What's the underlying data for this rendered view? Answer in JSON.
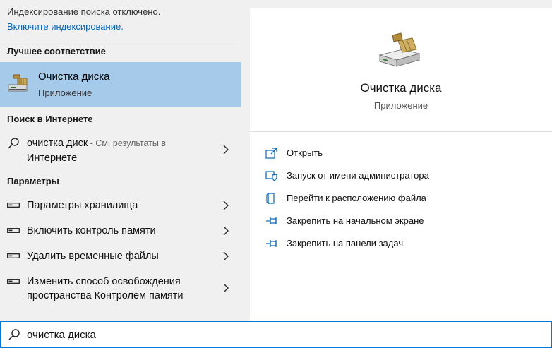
{
  "notice": {
    "text": "Индексирование поиска отключено.",
    "link": "Включите индексирование."
  },
  "best_match": {
    "header": "Лучшее соответствие",
    "title": "Очистка диска",
    "subtitle": "Приложение"
  },
  "web": {
    "header": "Поиск в Интернете",
    "query": "очистка диск",
    "suffix_line1": " - См. результаты в",
    "suffix_line2": "Интернете"
  },
  "settings": {
    "header": "Параметры",
    "items": [
      {
        "label": "Параметры хранилища"
      },
      {
        "label": "Включить контроль памяти"
      },
      {
        "label": "Удалить временные файлы"
      },
      {
        "label": "Изменить способ освобождения",
        "label2": "пространства Контролем памяти"
      }
    ]
  },
  "preview": {
    "title": "Очистка диска",
    "subtitle": "Приложение",
    "actions": [
      {
        "label": "Открыть",
        "icon": "open-icon"
      },
      {
        "label": "Запуск от имени администратора",
        "icon": "shield-icon"
      },
      {
        "label": "Перейти к расположению файла",
        "icon": "file-location-icon"
      },
      {
        "label": "Закрепить на начальном экране",
        "icon": "pin-icon"
      },
      {
        "label": "Закрепить на панели задач",
        "icon": "pin-icon"
      }
    ]
  },
  "search": {
    "value": "очистка диска"
  },
  "colors": {
    "selection": "#a6cbea",
    "accent": "#0078d7",
    "link": "#0067c0"
  }
}
